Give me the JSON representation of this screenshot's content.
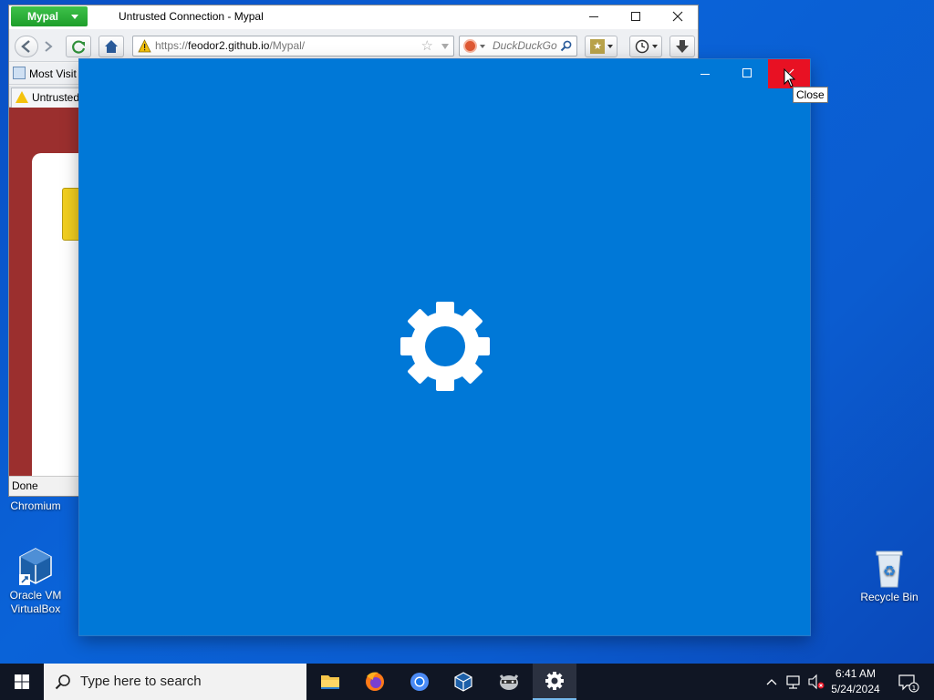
{
  "desktop": {
    "icons": [
      {
        "label": "Chromium"
      },
      {
        "label": "Oracle VM VirtualBox"
      },
      {
        "label": "Recycle Bin"
      }
    ]
  },
  "browser": {
    "app_button": "Mypal",
    "window_title": "Untrusted Connection - Mypal",
    "url_prefix": "https://",
    "url_host": "feodor2.github.io",
    "url_path": "/Mypal/",
    "search_placeholder": "DuckDuckGo",
    "bookmark_label": "Most Visit",
    "tab_label": "Untrusted",
    "status_text": "Done",
    "accent_color": "#1ea62b"
  },
  "settings_window": {
    "background_color": "#0078d7",
    "close_color": "#e81123",
    "tooltip": "Close",
    "center_icon": "gear-icon"
  },
  "taskbar": {
    "search_placeholder": "Type here to search",
    "apps": [
      "file-explorer-icon",
      "firefox-icon",
      "chromium-icon",
      "virtualbox-icon",
      "app-raccoon-icon",
      "settings-gear-icon"
    ],
    "active_app": "settings-gear-icon",
    "time": "6:41 AM",
    "date": "5/24/2024"
  }
}
